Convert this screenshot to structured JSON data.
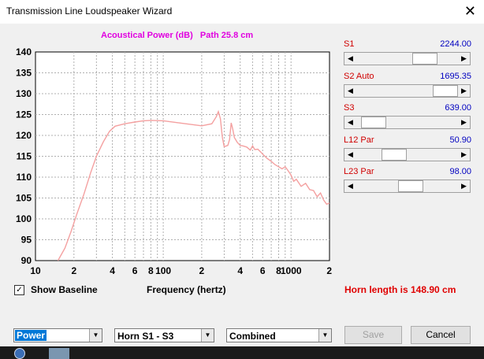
{
  "window": {
    "title": "Transmission Line Loudspeaker Wizard",
    "close_glyph": "✕"
  },
  "chart": {
    "title": "Acoustical Power (dB)   Path 25.8 cm",
    "xlabel": "Frequency (hertz)"
  },
  "chart_data": {
    "type": "line",
    "title": "Acoustical Power (dB)   Path 25.8 cm",
    "xlabel": "Frequency (hertz)",
    "ylabel": "",
    "xscale": "log",
    "xlim": [
      10,
      2000
    ],
    "ylim": [
      90,
      140
    ],
    "grid": true,
    "x_tick_labels": [
      "10",
      "2",
      "4",
      "6",
      "8",
      "100",
      "2",
      "4",
      "6",
      "8",
      "1000",
      "2"
    ],
    "y_tick_labels": [
      "140",
      "135",
      "130",
      "125",
      "120",
      "115",
      "110",
      "105",
      "100",
      "95",
      "90"
    ],
    "series": [
      {
        "color": "#f4a0a0",
        "x": [
          15,
          17,
          19,
          21,
          24,
          27,
          30,
          34,
          38,
          42,
          50,
          60,
          70,
          80,
          100,
          150,
          200,
          240,
          260,
          270,
          280,
          290,
          300,
          320,
          330,
          340,
          350,
          360,
          380,
          400,
          420,
          450,
          480,
          500,
          520,
          550,
          580,
          600,
          650,
          700,
          750,
          800,
          850,
          900,
          950,
          1000,
          1050,
          1100,
          1200,
          1300,
          1400,
          1500,
          1600,
          1700,
          1800,
          1900,
          2000
        ],
        "y": [
          90,
          93,
          97,
          101,
          106,
          111,
          115,
          118.5,
          121,
          122.2,
          122.8,
          123.2,
          123.5,
          123.6,
          123.5,
          122.8,
          122.3,
          122.8,
          124.5,
          125.7,
          124,
          119.5,
          117.3,
          117.6,
          119,
          123,
          121.5,
          119.5,
          118.3,
          117.6,
          117.5,
          117.2,
          116.5,
          117.5,
          116.6,
          116.7,
          116,
          115.5,
          114.5,
          113.8,
          113,
          112.5,
          112,
          112.5,
          111.5,
          110.5,
          109,
          109.5,
          107.8,
          108.5,
          107,
          106.8,
          105.3,
          106.2,
          104.5,
          103.5,
          103.8
        ]
      }
    ]
  },
  "sliders": [
    {
      "label": "S1",
      "value": "2244.00",
      "position": 0.73
    },
    {
      "label": "S2  Auto",
      "value": "1695.35",
      "position": 1.0
    },
    {
      "label": "S3",
      "value": "639.00",
      "position": 0.06
    },
    {
      "label": "L12  Par",
      "value": "50.90",
      "position": 0.33
    },
    {
      "label": "L23  Par",
      "value": "98.00",
      "position": 0.55
    }
  ],
  "show_baseline": {
    "label": "Show Baseline",
    "checked": true,
    "check_glyph": "✓"
  },
  "horn_length": "Horn length is 148.90 cm",
  "selects": {
    "mode": "Power",
    "horn": "Horn S1 - S3",
    "combine": "Combined"
  },
  "buttons": {
    "save": "Save",
    "cancel": "Cancel"
  }
}
